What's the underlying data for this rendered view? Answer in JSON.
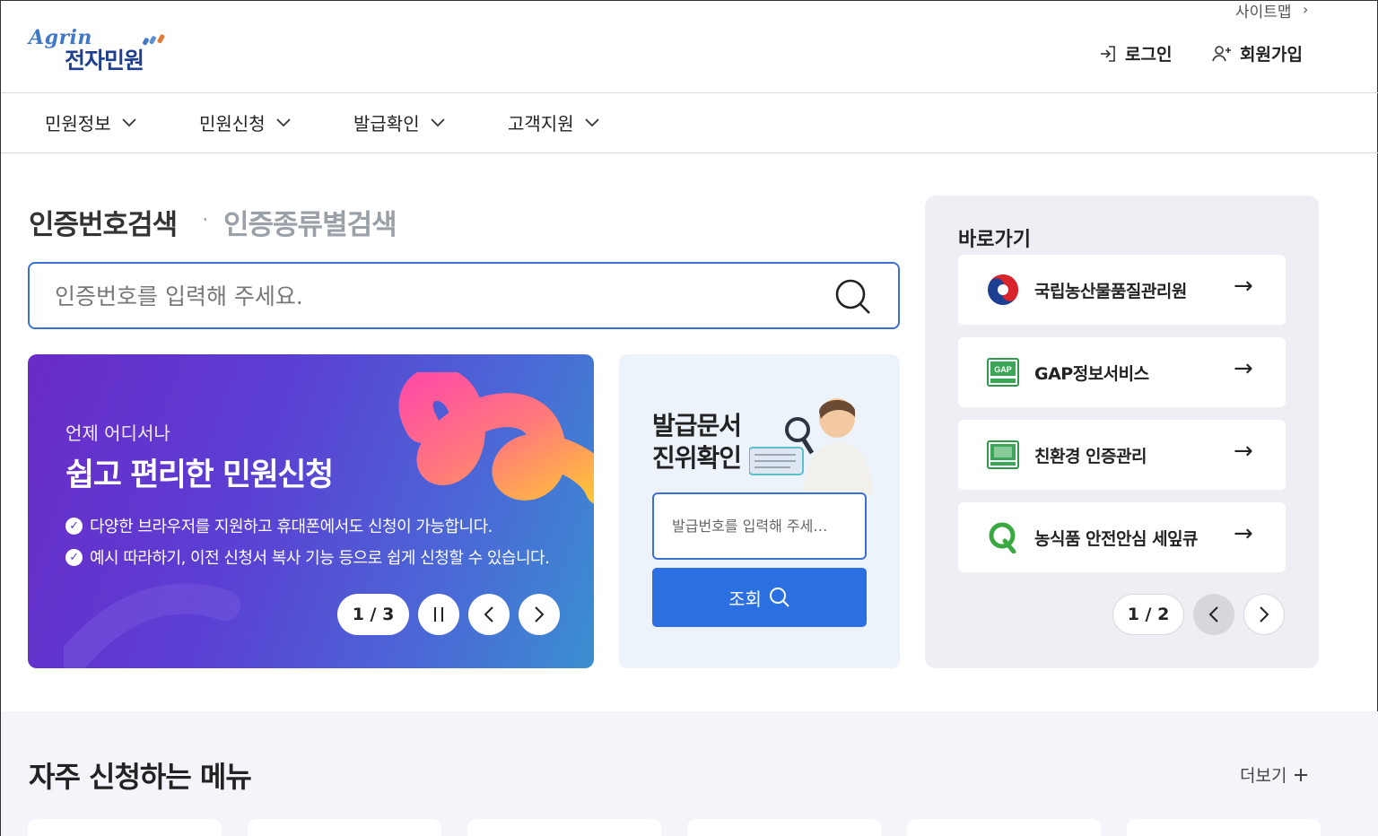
{
  "header": {
    "logo_en": "Agrin",
    "logo_ko": "전자민원",
    "sitemap": "사이트맵",
    "login": "로그인",
    "join": "회원가입"
  },
  "nav": [
    {
      "label": "민원정보"
    },
    {
      "label": "민원신청"
    },
    {
      "label": "발급확인"
    },
    {
      "label": "고객지원"
    }
  ],
  "search": {
    "tab_active": "인증번호검색",
    "tab_inactive": "인증종류별검색",
    "placeholder": "인증번호를 입력해 주세요."
  },
  "banner": {
    "subtitle": "언제 어디서나",
    "title": "쉽고 편리한 민원신청",
    "lines": [
      "다양한 브라우저를 지원하고 휴대폰에서도 신청이 가능합니다.",
      "예시 따라하기, 이전 신청서 복사 기능 등으로 쉽게 신청할 수 있습니다."
    ],
    "pager": "1 / 3",
    "colors": {
      "start": "#6a2bc8",
      "end": "#3a8fd0"
    }
  },
  "verify": {
    "title_line1": "발급문서",
    "title_line2": "진위확인",
    "placeholder": "발급번호를 입력해 주세…",
    "button": "조회"
  },
  "quick": {
    "title": "바로가기",
    "items": [
      {
        "label": "국립농산물품질관리원",
        "icon": "taegeuk-icon"
      },
      {
        "label": "GAP정보서비스",
        "icon": "gap-logo-icon"
      },
      {
        "label": "친환경 인증관리",
        "icon": "organic-logo-icon"
      },
      {
        "label": "농식품 안전안심 세잎큐",
        "icon": "q-logo-icon"
      }
    ],
    "pager": "1 / 2"
  },
  "frequent": {
    "title": "자주 신청하는 메뉴",
    "more": "더보기"
  }
}
